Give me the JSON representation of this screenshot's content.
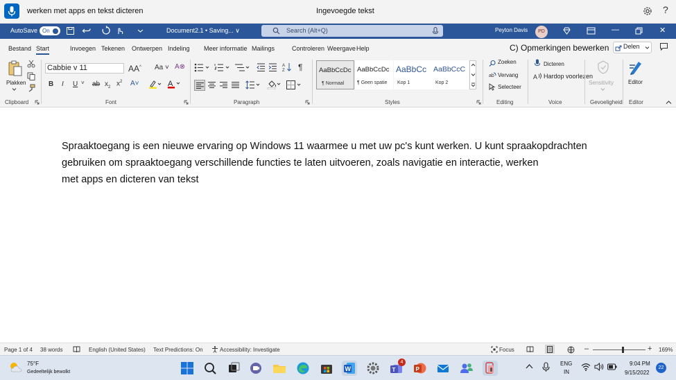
{
  "voice_access": {
    "command_text": "werken met apps en tekst dicteren",
    "status_text": "Ingevoegde tekst",
    "help_glyph": "?"
  },
  "title_bar": {
    "autosave_label": "AutoSave",
    "autosave_state": "On",
    "document_title": "Document2.1 • Saving... ∨",
    "search_placeholder": "Search (Alt+Q)",
    "user_name": "Peyton Davis",
    "user_initials": "PD"
  },
  "ribbon_tabs": {
    "tabs": [
      "Bestand",
      "Start",
      "Invoegen",
      "Tekenen",
      "Ontwerpen",
      "Indeling",
      "Meer informatie",
      "Mailings",
      "Controleren",
      "Weergave",
      "Help"
    ],
    "comments_label": "C) Opmerkingen bewerken",
    "share_label": "Delen"
  },
  "ribbon": {
    "clipboard": {
      "paste_label": "Plakken",
      "group_label": "Clipboard"
    },
    "font": {
      "font_name": "Cabbie v 11",
      "group_label": "Font"
    },
    "paragraph": {
      "group_label": "Paragraph"
    },
    "styles": {
      "items": [
        {
          "sample": "AaBbCcDc",
          "name": "¶ Normaal"
        },
        {
          "sample": "AaBbCcDc",
          "name": "¶ Geen spatie"
        },
        {
          "sample": "AaBbCc",
          "name": "Kop 1"
        },
        {
          "sample": "AaBbCcC",
          "name": "Kop 2"
        }
      ],
      "group_label": "Styles"
    },
    "editing": {
      "find_label": "Zoeken",
      "replace_label": "Vervang",
      "select_label": "Selecteer",
      "group_label": "Editing"
    },
    "voice": {
      "dictate_label": "Dicteren",
      "read_aloud_label": "Hardop voorlezen",
      "group_label": "Voice"
    },
    "sensitivity": {
      "label": "Sensitivity",
      "group_label": "Gevoeligheid"
    },
    "editor": {
      "label": "Editor",
      "group_label": "Editor"
    }
  },
  "document": {
    "lines": [
      "Spraaktoegang is een nieuwe ervaring op Windows 11 waarmee u met uw pc's kunt werken. U kunt spraakopdrachten",
      "gebruiken om spraaktoegang verschillende functies te laten uitvoeren, zoals navigatie en interactie, werken",
      "met apps en dicteren van tekst"
    ]
  },
  "status_bar": {
    "page": "Page 1 of 4",
    "words": "38 words",
    "language": "English (United States)",
    "text_predictions": "Text Predictions: On",
    "accessibility": "Accessibility: Investigate",
    "focus": "Focus",
    "zoom": "169%"
  },
  "taskbar": {
    "weather_temp": "75°F",
    "weather_desc": "Gedeeltelijk bewolkt",
    "teams_badge": "4",
    "language": "ENG",
    "region": "IN",
    "time": "9:04 PM",
    "date": "9/15/2022",
    "notifications": "22"
  },
  "colors": {
    "word_blue": "#2b579a",
    "voice_mic": "#0067c0",
    "ribbon_bg": "#f3f3f3",
    "taskbar_bg": "#dde6f0"
  }
}
